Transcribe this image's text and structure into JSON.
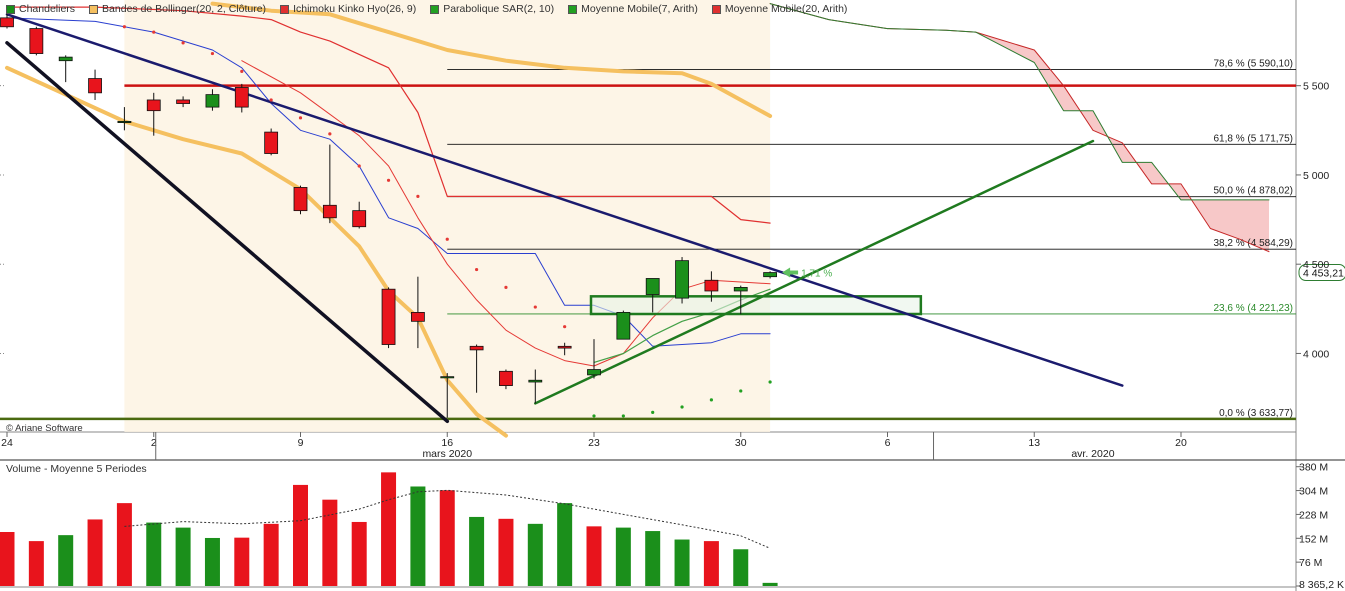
{
  "legend": [
    {
      "label": "Chandeliers",
      "color": "#1b8f1b"
    },
    {
      "label": "Bandes de Bollinger(20, 2, Clôture)",
      "color": "#f5c060"
    },
    {
      "label": "Ichimoku Kinko Hyo(26, 9)",
      "color": "#e03030"
    },
    {
      "label": "Parabolique SAR(2, 10)",
      "color": "#22a022"
    },
    {
      "label": "Moyenne Mobile(7, Arith)",
      "color": "#22a022"
    },
    {
      "label": "Moyenne Mobile(20, Arith)",
      "color": "#e03030"
    }
  ],
  "credit": "© Ariane Software",
  "volume_title": "Volume  - Moyenne 5 Periodes",
  "colors": {
    "up": "#1b8f1b",
    "down": "#e8141c",
    "bollinger": "#f5c060",
    "resistance": "#cc1111",
    "fibo": "#111111",
    "trend_down": "#1b1b6e",
    "trend_up": "#1f7a1f",
    "box": "#1f7a1f",
    "cloud_bear": "#f7c8c8",
    "kijun": "#e03030",
    "tenkan": "#2a3fd0"
  },
  "chart_data": [
    {
      "type": "candlestick",
      "title": "",
      "ylim": [
        3560,
        5980
      ],
      "y_ticks": [
        4000,
        4500,
        5000,
        5500
      ],
      "y_tick_labels": [
        "4 000",
        "4 500",
        "5 000",
        "5 500"
      ],
      "x_tick_labels": [
        {
          "label": "24",
          "day": 0
        },
        {
          "label": "2",
          "day": 5
        },
        {
          "label": "9",
          "day": 10
        },
        {
          "label": "16",
          "day": 15
        },
        {
          "label": "23",
          "day": 20
        },
        {
          "label": "30",
          "day": 25
        },
        {
          "label": "6",
          "day": 30
        },
        {
          "label": "13",
          "day": 35
        },
        {
          "label": "20",
          "day": 40
        }
      ],
      "month_labels": [
        {
          "label": "mars 2020",
          "day": 15
        },
        {
          "label": "avr. 2020",
          "day": 37
        }
      ],
      "last_price_label": "4 453,21",
      "last_price": 4453.21,
      "change_label": "1,71 %",
      "candles": [
        {
          "day": 0,
          "o": 5880,
          "h": 5940,
          "l": 5820,
          "c": 5830
        },
        {
          "day": 1,
          "o": 5820,
          "h": 5830,
          "l": 5670,
          "c": 5680
        },
        {
          "day": 2,
          "o": 5640,
          "h": 5670,
          "l": 5520,
          "c": 5660
        },
        {
          "day": 3,
          "o": 5540,
          "h": 5590,
          "l": 5420,
          "c": 5460
        },
        {
          "day": 4,
          "o": 5300,
          "h": 5380,
          "l": 5250,
          "c": 5300
        },
        {
          "day": 5,
          "o": 5420,
          "h": 5460,
          "l": 5220,
          "c": 5360
        },
        {
          "day": 6,
          "o": 5420,
          "h": 5440,
          "l": 5380,
          "c": 5400
        },
        {
          "day": 7,
          "o": 5380,
          "h": 5480,
          "l": 5360,
          "c": 5450
        },
        {
          "day": 8,
          "o": 5490,
          "h": 5510,
          "l": 5350,
          "c": 5380
        },
        {
          "day": 9,
          "o": 5240,
          "h": 5260,
          "l": 5110,
          "c": 5120
        },
        {
          "day": 10,
          "o": 4930,
          "h": 4940,
          "l": 4780,
          "c": 4800
        },
        {
          "day": 11,
          "o": 4830,
          "h": 5170,
          "l": 4730,
          "c": 4760
        },
        {
          "day": 12,
          "o": 4800,
          "h": 4850,
          "l": 4700,
          "c": 4710
        },
        {
          "day": 13,
          "o": 4360,
          "h": 4370,
          "l": 4030,
          "c": 4050
        },
        {
          "day": 14,
          "o": 4230,
          "h": 4430,
          "l": 4030,
          "c": 4180
        },
        {
          "day": 15,
          "o": 3870,
          "h": 3890,
          "l": 3640,
          "c": 3870
        },
        {
          "day": 16,
          "o": 4040,
          "h": 4050,
          "l": 3780,
          "c": 4020
        },
        {
          "day": 17,
          "o": 3900,
          "h": 3910,
          "l": 3800,
          "c": 3820
        },
        {
          "day": 18,
          "o": 3840,
          "h": 3910,
          "l": 3720,
          "c": 3850
        },
        {
          "day": 19,
          "o": 4040,
          "h": 4060,
          "l": 3990,
          "c": 4030
        },
        {
          "day": 20,
          "o": 3880,
          "h": 4080,
          "l": 3860,
          "c": 3910
        },
        {
          "day": 21,
          "o": 4080,
          "h": 4240,
          "l": 4080,
          "c": 4230
        },
        {
          "day": 22,
          "o": 4330,
          "h": 4420,
          "l": 4230,
          "c": 4420
        },
        {
          "day": 23,
          "o": 4310,
          "h": 4540,
          "l": 4280,
          "c": 4520
        },
        {
          "day": 24,
          "o": 4410,
          "h": 4460,
          "l": 4290,
          "c": 4350
        },
        {
          "day": 25,
          "o": 4350,
          "h": 4380,
          "l": 4220,
          "c": 4370
        },
        {
          "day": 26,
          "o": 4430,
          "h": 4460,
          "l": 4420,
          "c": 4453.21
        }
      ],
      "fibonacci": [
        {
          "label": "78,6 % (5 590,10)",
          "value": 5590.1
        },
        {
          "label": "61,8 % (5 171,75)",
          "value": 5171.75
        },
        {
          "label": "50,0 % (4 878,02)",
          "value": 4878.02
        },
        {
          "label": "38,2 % (4 584,29)",
          "value": 4584.29
        },
        {
          "label": "23,6 % (4 221,23)",
          "value": 4221.23
        },
        {
          "label": "0,0 % (3 633,77)",
          "value": 3633.77
        }
      ],
      "resistance_level": 5500,
      "support_zone": {
        "from_day": 20,
        "to_day": 31,
        "low": 4221,
        "high": 4320
      },
      "trendlines": [
        {
          "name": "down-channel-upper",
          "points": [
            [
              0,
              5900
            ],
            [
              38,
              3820
            ]
          ]
        },
        {
          "name": "down-channel-lower",
          "points": [
            [
              0,
              5740
            ],
            [
              15,
              3620
            ]
          ]
        },
        {
          "name": "up-trend",
          "points": [
            [
              18,
              3720
            ],
            [
              37,
              5190
            ]
          ]
        }
      ],
      "bollinger": {
        "upper": [
          [
            7,
            5960
          ],
          [
            9,
            5920
          ],
          [
            11,
            5900
          ],
          [
            13,
            5800
          ],
          [
            15,
            5700
          ],
          [
            17,
            5640
          ],
          [
            19,
            5600
          ],
          [
            21,
            5580
          ],
          [
            23,
            5570
          ],
          [
            24,
            5510
          ],
          [
            25,
            5420
          ],
          [
            26,
            5330
          ]
        ],
        "lower": [
          [
            0,
            5600
          ],
          [
            2,
            5450
          ],
          [
            4,
            5300
          ],
          [
            6,
            5200
          ],
          [
            8,
            5120
          ],
          [
            10,
            4920
          ],
          [
            12,
            4600
          ],
          [
            13,
            4350
          ],
          [
            14,
            4200
          ],
          [
            15,
            3850
          ],
          [
            16,
            3660
          ],
          [
            17,
            3540
          ]
        ]
      },
      "kijun": [
        [
          0,
          5940
        ],
        [
          3,
          5940
        ],
        [
          6,
          5920
        ],
        [
          8,
          5890
        ],
        [
          9,
          5870
        ],
        [
          10,
          5800
        ],
        [
          11,
          5750
        ],
        [
          13,
          5600
        ],
        [
          14,
          5350
        ],
        [
          15,
          4880
        ],
        [
          20,
          4880
        ],
        [
          24,
          4880
        ],
        [
          25,
          4750
        ],
        [
          26,
          4730
        ]
      ],
      "tenkan": [
        [
          0,
          5880
        ],
        [
          3,
          5860
        ],
        [
          5,
          5800
        ],
        [
          7,
          5700
        ],
        [
          8,
          5600
        ],
        [
          9,
          5400
        ],
        [
          10,
          5250
        ],
        [
          11,
          5200
        ],
        [
          12,
          5050
        ],
        [
          13,
          4760
        ],
        [
          14,
          4700
        ],
        [
          15,
          4560
        ],
        [
          18,
          4560
        ],
        [
          19,
          4270
        ],
        [
          20,
          4270
        ],
        [
          21,
          4210
        ],
        [
          22,
          4040
        ],
        [
          24,
          4060
        ],
        [
          25,
          4110
        ],
        [
          26,
          4110
        ]
      ],
      "senkou_a": [
        [
          26,
          5960
        ],
        [
          28,
          5870
        ],
        [
          30,
          5820
        ],
        [
          32,
          5810
        ],
        [
          33,
          5800
        ],
        [
          35,
          5700
        ],
        [
          36,
          5500
        ],
        [
          37,
          5250
        ],
        [
          38,
          5180
        ],
        [
          39,
          4950
        ],
        [
          40,
          4950
        ],
        [
          41,
          4700
        ],
        [
          42,
          4640
        ],
        [
          43,
          4570
        ]
      ],
      "senkou_b": [
        [
          26,
          5960
        ],
        [
          28,
          5870
        ],
        [
          30,
          5820
        ],
        [
          32,
          5810
        ],
        [
          33,
          5800
        ],
        [
          35,
          5630
        ],
        [
          36,
          5360
        ],
        [
          37,
          5360
        ],
        [
          38,
          5070
        ],
        [
          39,
          5070
        ],
        [
          40,
          4860
        ],
        [
          41,
          4860
        ],
        [
          42,
          4860
        ],
        [
          43,
          4860
        ]
      ],
      "ma_red": [
        [
          8,
          5640
        ],
        [
          10,
          5460
        ],
        [
          12,
          5220
        ],
        [
          13,
          5050
        ],
        [
          14,
          4760
        ],
        [
          15,
          4500
        ],
        [
          16,
          4300
        ],
        [
          17,
          4130
        ],
        [
          18,
          4030
        ],
        [
          19,
          3960
        ],
        [
          20,
          3930
        ],
        [
          21,
          4000
        ],
        [
          22,
          4200
        ],
        [
          23,
          4360
        ],
        [
          24,
          4410
        ],
        [
          25,
          4400
        ],
        [
          26,
          4390
        ]
      ],
      "ma_green": [
        [
          20,
          3950
        ],
        [
          21,
          4000
        ],
        [
          22,
          4100
        ],
        [
          23,
          4180
        ],
        [
          24,
          4230
        ],
        [
          25,
          4300
        ],
        [
          26,
          4360
        ]
      ],
      "sar": [
        {
          "day": 4,
          "v": 5830
        },
        {
          "day": 5,
          "v": 5800
        },
        {
          "day": 6,
          "v": 5740
        },
        {
          "day": 7,
          "v": 5680
        },
        {
          "day": 8,
          "v": 5580
        },
        {
          "day": 9,
          "v": 5420
        },
        {
          "day": 10,
          "v": 5320
        },
        {
          "day": 11,
          "v": 5230
        },
        {
          "day": 12,
          "v": 5050
        },
        {
          "day": 13,
          "v": 4970
        },
        {
          "day": 14,
          "v": 4880
        },
        {
          "day": 15,
          "v": 4640
        },
        {
          "day": 16,
          "v": 4470
        },
        {
          "day": 17,
          "v": 4370
        },
        {
          "day": 18,
          "v": 4260
        },
        {
          "day": 19,
          "v": 4150
        },
        {
          "day": 20,
          "v": 3650
        },
        {
          "day": 21,
          "v": 3650
        },
        {
          "day": 22,
          "v": 3670
        },
        {
          "day": 23,
          "v": 3700
        },
        {
          "day": 24,
          "v": 3740
        },
        {
          "day": 25,
          "v": 3790
        },
        {
          "day": 26,
          "v": 3840
        }
      ]
    },
    {
      "type": "bar",
      "title": "Volume  - Moyenne 5 Periodes",
      "ylim": [
        0,
        395
      ],
      "y_tick_labels": [
        "380 M",
        "304 M",
        "228 M",
        "152 M",
        "76 M",
        "8 365,2 K"
      ],
      "y_ticks": [
        380,
        304,
        228,
        152,
        76,
        0
      ],
      "values": [
        172,
        143,
        162,
        212,
        264,
        202,
        186,
        153,
        154,
        198,
        322,
        275,
        204,
        362,
        317,
        305,
        220,
        214,
        198,
        264,
        190,
        186,
        175,
        148,
        143,
        117,
        10
      ],
      "up": [
        false,
        false,
        true,
        false,
        false,
        true,
        true,
        true,
        false,
        false,
        false,
        false,
        false,
        false,
        true,
        false,
        true,
        false,
        true,
        true,
        false,
        true,
        true,
        true,
        false,
        true,
        true
      ],
      "average": [
        [
          4,
          190
        ],
        [
          6,
          205
        ],
        [
          8,
          198
        ],
        [
          10,
          208
        ],
        [
          12,
          245
        ],
        [
          13,
          275
        ],
        [
          14,
          300
        ],
        [
          15,
          305
        ],
        [
          17,
          290
        ],
        [
          19,
          262
        ],
        [
          21,
          228
        ],
        [
          23,
          195
        ],
        [
          25,
          160
        ],
        [
          26,
          120
        ]
      ]
    }
  ]
}
